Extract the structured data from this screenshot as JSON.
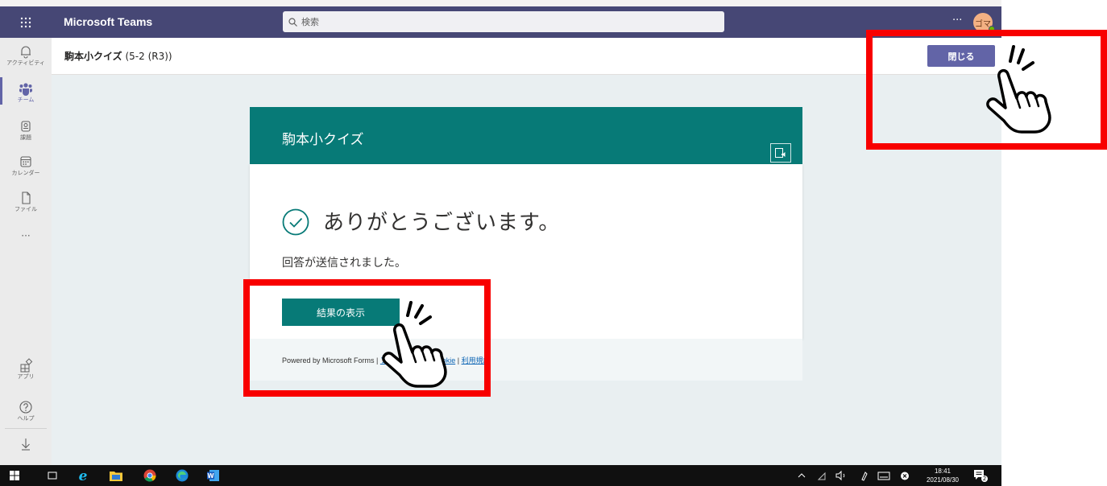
{
  "app": {
    "title": "Microsoft Teams",
    "search_placeholder": "検索",
    "more_label": "···",
    "avatar_initials": "ゴマ"
  },
  "rail": {
    "items": [
      {
        "label": "アクティビティ",
        "icon": "bell-icon"
      },
      {
        "label": "チーム",
        "icon": "teams-icon"
      },
      {
        "label": "課題",
        "icon": "assignments-icon"
      },
      {
        "label": "カレンダー",
        "icon": "calendar-icon"
      },
      {
        "label": "ファイル",
        "icon": "file-icon"
      },
      {
        "label": "···",
        "icon": "more-icon"
      }
    ],
    "bottom": [
      {
        "label": "アプリ",
        "icon": "apps-icon"
      },
      {
        "label": "ヘルプ",
        "icon": "help-icon"
      }
    ]
  },
  "header": {
    "title": "駒本小クイズ",
    "subtitle": "(5-2 (R3))",
    "close_label": "閉じる"
  },
  "form": {
    "title": "駒本小クイズ",
    "thanks": "ありがとうございます。",
    "sent_message": "回答が送信されました。",
    "results_button": "結果の表示",
    "footer_powered": "Powered by Microsoft Forms | ",
    "footer_privacy": "プライバシーと Cookie",
    "footer_sep": " | ",
    "footer_terms": "利用規約"
  },
  "taskbar": {
    "time": "18:41",
    "date": "2021/08/30",
    "notification_count": "2"
  },
  "colors": {
    "teams_purple": "#464775",
    "accent": "#6264a7",
    "forms_teal": "#077a77",
    "annotation_red": "#f80000"
  }
}
